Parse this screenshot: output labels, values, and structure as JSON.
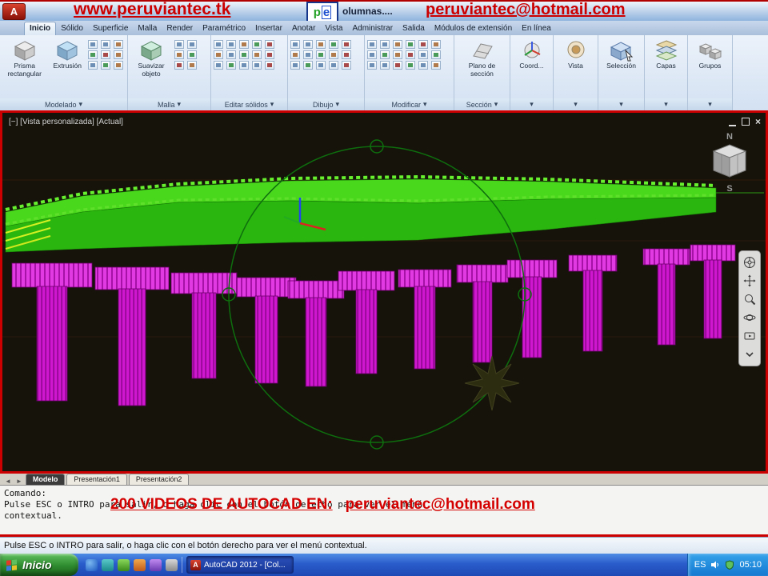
{
  "titlebar": {
    "logo_letter": "A",
    "url_overlay": "www.peruviantec.tk",
    "pe_logo": {
      "p": "p",
      "e": "e"
    },
    "window_title": "olumnas....",
    "email_overlay": "peruviantec@hotmail.com"
  },
  "ribbon": {
    "tabs": [
      "Inicio",
      "Sólido",
      "Superficie",
      "Malla",
      "Render",
      "Paramétrico",
      "Insertar",
      "Anotar",
      "Vista",
      "Administrar",
      "Salida",
      "Módulos de extensión",
      "En línea"
    ],
    "active_tab": "Inicio",
    "buttons": {
      "prisma": "Prisma rectangular",
      "extrusion": "Extrusión",
      "suavizar": "Suavizar objeto",
      "plano": "Plano de sección",
      "coord": "Coord...",
      "vista": "Vista",
      "seleccion": "Selección",
      "capas": "Capas",
      "grupos": "Grupos"
    },
    "panel_labels": {
      "modelado": "Modelado",
      "malla": "Malla",
      "editar": "Editar sólidos",
      "dibujo": "Dibujo",
      "modificar": "Modificar",
      "seccion": "Sección"
    },
    "dropdown_arrow": "▾"
  },
  "viewport": {
    "label": "[−] [Vista personalizada] [Actual]",
    "viewcube": {
      "north": "N",
      "south": "S"
    },
    "window_controls": [
      "minimize-icon",
      "restore-icon",
      "close-icon"
    ],
    "colors": {
      "background": "#15130a",
      "deck_green": "#2ab60e",
      "pier_magenta": "#cf17cf",
      "orbit_green": "#0e6e0e",
      "border_red": "#cc0000"
    }
  },
  "layout_tabs": {
    "model": "Modelo",
    "p1": "Presentación1",
    "p2": "Presentación2"
  },
  "command": {
    "line1": "Comando:",
    "line2": "Pulse ESC o INTRO para salir, o haga clic con el botón derecho para ver el menú",
    "line3": "contextual.",
    "overlay_title": "200 VIDEOS DE AUTOCAD EN:",
    "overlay_email": "peruviantec@hotmail.com"
  },
  "statusbar": {
    "message": "Pulse ESC o INTRO para salir, o haga clic con el botón derecho para ver el menú contextual."
  },
  "taskbar": {
    "start_label": "Inicio",
    "task_label": "AutoCAD 2012 - [Col...",
    "tray_language": "ES",
    "tray_time": "05:10"
  }
}
